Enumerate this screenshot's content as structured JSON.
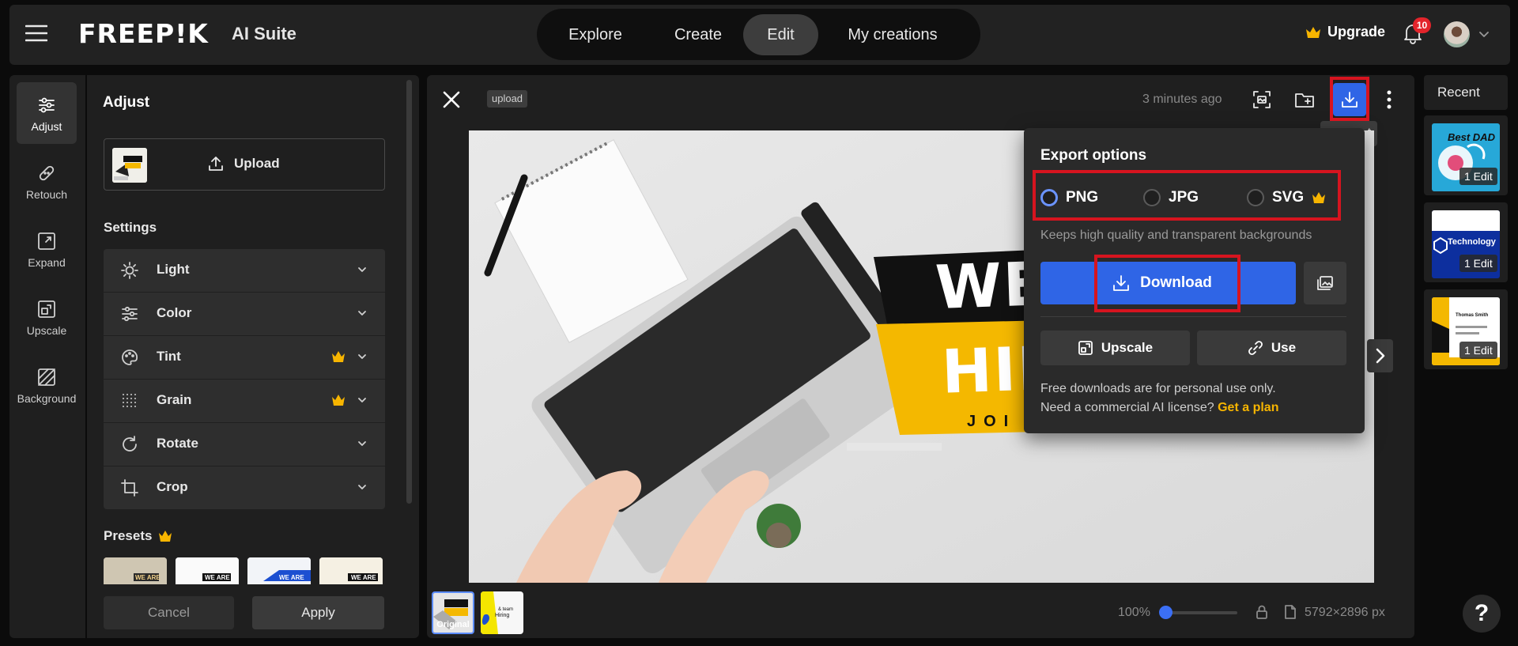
{
  "header": {
    "logo": "FREEP!K",
    "suite": "AI Suite",
    "nav": [
      "Explore",
      "Create",
      "Edit",
      "My creations"
    ],
    "active_nav": "Edit",
    "upgrade_label": "Upgrade",
    "notification_count": "10"
  },
  "rail": {
    "items": [
      "Adjust",
      "Retouch",
      "Expand",
      "Upscale",
      "Background"
    ],
    "active": "Adjust"
  },
  "panel": {
    "title": "Adjust",
    "upload_label": "Upload",
    "settings_label": "Settings",
    "settings": [
      {
        "label": "Light",
        "icon": "sun-icon",
        "premium": false
      },
      {
        "label": "Color",
        "icon": "sliders-icon",
        "premium": false
      },
      {
        "label": "Tint",
        "icon": "palette-icon",
        "premium": true
      },
      {
        "label": "Grain",
        "icon": "grain-icon",
        "premium": true
      },
      {
        "label": "Rotate",
        "icon": "rotate-icon",
        "premium": false
      },
      {
        "label": "Crop",
        "icon": "crop-icon",
        "premium": false
      }
    ],
    "presets_label": "Presets",
    "preset_text": "WE ARE",
    "cancel_label": "Cancel",
    "apply_label": "Apply"
  },
  "editor": {
    "tag": "upload",
    "timestamp": "3 minutes ago",
    "tooltip_fragment": "t",
    "canvas_text": {
      "line1": "WE A",
      "line2": "HIR",
      "line3": "JOI"
    },
    "thumbs": [
      {
        "label": "Original",
        "active": true
      },
      {
        "label": "",
        "active": false
      }
    ],
    "zoom": "100%",
    "dimensions": "5792×2896 px"
  },
  "export": {
    "title": "Export options",
    "formats": [
      {
        "label": "PNG",
        "checked": true,
        "premium": false
      },
      {
        "label": "JPG",
        "checked": false,
        "premium": false
      },
      {
        "label": "SVG",
        "checked": false,
        "premium": true
      }
    ],
    "note": "Keeps high quality and transparent backgrounds",
    "download_label": "Download",
    "upscale_label": "Upscale",
    "use_label": "Use",
    "footer_line1": "Free downloads are for personal use only.",
    "footer_line2": "Need a commercial AI license?",
    "footer_link": "Get a plan"
  },
  "recent": {
    "title": "Recent",
    "cards": [
      {
        "badge": "1 Edit",
        "text": "Best DAD"
      },
      {
        "badge": "1 Edit",
        "text": "Technology"
      },
      {
        "badge": "1 Edit",
        "text": "Thomas Smith"
      }
    ]
  },
  "colors": {
    "accent": "#2f65e6",
    "premium": "#f7b500",
    "annotation": "#d6141f"
  }
}
